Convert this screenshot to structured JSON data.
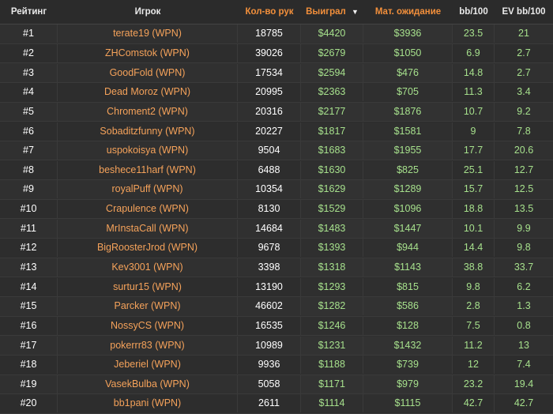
{
  "columns": {
    "rank": "Рейтинг",
    "player": "Игрок",
    "hands": "Кол-во рук",
    "won": "Выиграл",
    "ev": "Мат. ожидание",
    "bb100": "bb/100",
    "evbb100": "EV bb/100"
  },
  "colors": {
    "background": "#2b2b2b",
    "player_orange": "#f5a25a",
    "header_orange": "#f28f3b",
    "value_green": "#a6e08c"
  },
  "icons": {
    "sort": "caret-down-icon"
  },
  "rows": [
    {
      "rank": "#1",
      "player": "terate19 (WPN)",
      "hands": "18785",
      "won": "$4420",
      "ev": "$3936",
      "bb": "23.5",
      "evbb": "21"
    },
    {
      "rank": "#2",
      "player": "ZHComstok (WPN)",
      "hands": "39026",
      "won": "$2679",
      "ev": "$1050",
      "bb": "6.9",
      "evbb": "2.7"
    },
    {
      "rank": "#3",
      "player": "GoodFold (WPN)",
      "hands": "17534",
      "won": "$2594",
      "ev": "$476",
      "bb": "14.8",
      "evbb": "2.7"
    },
    {
      "rank": "#4",
      "player": "Dead Moroz (WPN)",
      "hands": "20995",
      "won": "$2363",
      "ev": "$705",
      "bb": "11.3",
      "evbb": "3.4"
    },
    {
      "rank": "#5",
      "player": "Chroment2 (WPN)",
      "hands": "20316",
      "won": "$2177",
      "ev": "$1876",
      "bb": "10.7",
      "evbb": "9.2"
    },
    {
      "rank": "#6",
      "player": "Sobaditzfunny (WPN)",
      "hands": "20227",
      "won": "$1817",
      "ev": "$1581",
      "bb": "9",
      "evbb": "7.8"
    },
    {
      "rank": "#7",
      "player": "uspokoisya (WPN)",
      "hands": "9504",
      "won": "$1683",
      "ev": "$1955",
      "bb": "17.7",
      "evbb": "20.6"
    },
    {
      "rank": "#8",
      "player": "beshece11harf (WPN)",
      "hands": "6488",
      "won": "$1630",
      "ev": "$825",
      "bb": "25.1",
      "evbb": "12.7"
    },
    {
      "rank": "#9",
      "player": "royalPuff (WPN)",
      "hands": "10354",
      "won": "$1629",
      "ev": "$1289",
      "bb": "15.7",
      "evbb": "12.5"
    },
    {
      "rank": "#10",
      "player": "Crapulence (WPN)",
      "hands": "8130",
      "won": "$1529",
      "ev": "$1096",
      "bb": "18.8",
      "evbb": "13.5"
    },
    {
      "rank": "#11",
      "player": "MrInstaCall (WPN)",
      "hands": "14684",
      "won": "$1483",
      "ev": "$1447",
      "bb": "10.1",
      "evbb": "9.9"
    },
    {
      "rank": "#12",
      "player": "BigRoosterJrod (WPN)",
      "hands": "9678",
      "won": "$1393",
      "ev": "$944",
      "bb": "14.4",
      "evbb": "9.8"
    },
    {
      "rank": "#13",
      "player": "Kev3001 (WPN)",
      "hands": "3398",
      "won": "$1318",
      "ev": "$1143",
      "bb": "38.8",
      "evbb": "33.7"
    },
    {
      "rank": "#14",
      "player": "surtur15 (WPN)",
      "hands": "13190",
      "won": "$1293",
      "ev": "$815",
      "bb": "9.8",
      "evbb": "6.2"
    },
    {
      "rank": "#15",
      "player": "Parcker (WPN)",
      "hands": "46602",
      "won": "$1282",
      "ev": "$586",
      "bb": "2.8",
      "evbb": "1.3"
    },
    {
      "rank": "#16",
      "player": "NossyCS (WPN)",
      "hands": "16535",
      "won": "$1246",
      "ev": "$128",
      "bb": "7.5",
      "evbb": "0.8"
    },
    {
      "rank": "#17",
      "player": "pokerrr83 (WPN)",
      "hands": "10989",
      "won": "$1231",
      "ev": "$1432",
      "bb": "11.2",
      "evbb": "13"
    },
    {
      "rank": "#18",
      "player": "Jeberiel (WPN)",
      "hands": "9936",
      "won": "$1188",
      "ev": "$739",
      "bb": "12",
      "evbb": "7.4"
    },
    {
      "rank": "#19",
      "player": "VasekBulba (WPN)",
      "hands": "5058",
      "won": "$1171",
      "ev": "$979",
      "bb": "23.2",
      "evbb": "19.4"
    },
    {
      "rank": "#20",
      "player": "bb1pani (WPN)",
      "hands": "2611",
      "won": "$1114",
      "ev": "$1115",
      "bb": "42.7",
      "evbb": "42.7"
    }
  ]
}
